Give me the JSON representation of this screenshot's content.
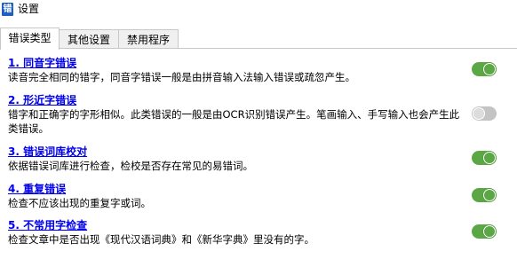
{
  "window": {
    "title": "设置",
    "icon_glyph": "错"
  },
  "tabs": [
    {
      "label": "错误类型",
      "active": true
    },
    {
      "label": "其他设置",
      "active": false
    },
    {
      "label": "禁用程序",
      "active": false
    }
  ],
  "items": [
    {
      "title": "1. 同音字错误",
      "desc": "读音完全相同的错字，同音字错误一般是由拼音输入法输入错误或疏忽产生。",
      "enabled": true
    },
    {
      "title": "2. 形近字错误",
      "desc": "错字和正确字的字形相似。此类错误的一般是由OCR识别错误产生。笔画输入、手写输入也会产生此类错误。",
      "enabled": false
    },
    {
      "title": "3. 错误词库校对",
      "desc": "依据错误词库进行检查，检校是否存在常见的易错词。",
      "enabled": true
    },
    {
      "title": "4. 重复错误",
      "desc": "检查不应该出现的重复字或词。",
      "enabled": true
    },
    {
      "title": "5. 不常用字检查",
      "desc": "检查文章中是否出现《现代汉语词典》和《新华字典》里没有的字。",
      "enabled": true
    }
  ],
  "colors": {
    "link": "#0000ee",
    "toggle_on": "#5ca745",
    "toggle_off": "#c4c4c4"
  }
}
